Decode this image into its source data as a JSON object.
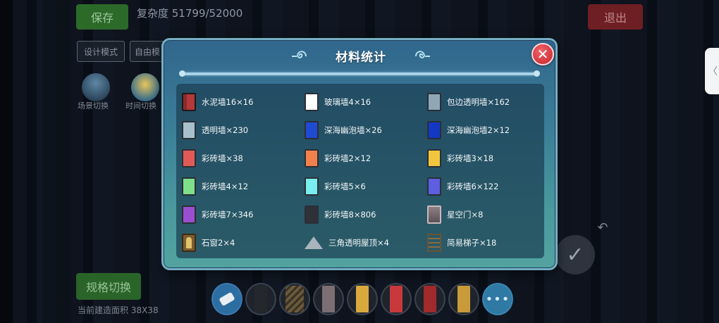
{
  "hud": {
    "save_label": "保存",
    "complexity_text": "复杂度 51799/52000",
    "exit_label": "退出",
    "design_mode_label": "设计模式",
    "free_mode_label": "自由模",
    "scene_toggle_label": "场景切换",
    "time_toggle_label": "时间切换",
    "scene_switch_label": "规格切换",
    "area_text": "当前建造面积 38X38",
    "side_tab_glyph": "〈"
  },
  "dialog": {
    "title": "材料统计",
    "close_glyph": "✕"
  },
  "materials": [
    {
      "label": "水泥墙16×16",
      "icon": "cement-wall",
      "color": "#b3393a"
    },
    {
      "label": "玻璃墙4×16",
      "icon": "glass-wall",
      "color": "#ffffff"
    },
    {
      "label": "包边透明墙×162",
      "icon": "edged-transparent-wall",
      "color": "#8fa7b5"
    },
    {
      "label": "透明墙×230",
      "icon": "transparent-wall",
      "color": "#a8c0cc"
    },
    {
      "label": "深海幽泡墙×26",
      "icon": "deep-sea-bubble-wall",
      "color": "#1f4bd2"
    },
    {
      "label": "深海幽泡墙2×12",
      "icon": "deep-sea-bubble-wall-2",
      "color": "#1238c4"
    },
    {
      "label": "彩砖墙×38",
      "icon": "color-brick-wall",
      "color": "#e25a58"
    },
    {
      "label": "彩砖墙2×12",
      "icon": "color-brick-wall-2",
      "color": "#f0814a"
    },
    {
      "label": "彩砖墙3×18",
      "icon": "color-brick-wall-3",
      "color": "#f2c53f"
    },
    {
      "label": "彩砖墙4×12",
      "icon": "color-brick-wall-4",
      "color": "#7ee08b"
    },
    {
      "label": "彩砖墙5×6",
      "icon": "color-brick-wall-5",
      "color": "#78eef0"
    },
    {
      "label": "彩砖墙6×122",
      "icon": "color-brick-wall-6",
      "color": "#5d5ee0"
    },
    {
      "label": "彩砖墙7×346",
      "icon": "color-brick-wall-7",
      "color": "#9a4fd0"
    },
    {
      "label": "彩砖墙8×806",
      "icon": "color-brick-wall-8",
      "color": "#2e3238"
    },
    {
      "label": "星空门×8",
      "icon": "starry-door",
      "color": "#7b6f74"
    },
    {
      "label": "石窗2×4",
      "icon": "stone-window",
      "color": "#7a5d32"
    },
    {
      "label": "三角透明屋顶×4",
      "icon": "triangle-transparent-roof",
      "color": "#a9b4bd"
    },
    {
      "label": "简易梯子×18",
      "icon": "simple-ladder",
      "color": "#8a6c40"
    }
  ],
  "hotbar": {
    "items": [
      {
        "icon": "eraser-icon",
        "color": "#2d6ea2"
      },
      {
        "icon": "black-wall",
        "color": "#24272c"
      },
      {
        "icon": "stair",
        "color": "#6b5a3b"
      },
      {
        "icon": "starry-door",
        "color": "#7b6f74"
      },
      {
        "icon": "yellow-block",
        "color": "#d9a93d"
      },
      {
        "icon": "red-block",
        "color": "#c7393b"
      },
      {
        "icon": "red-door",
        "color": "#a02a2c"
      },
      {
        "icon": "yellow-window",
        "color": "#c99a3a"
      }
    ],
    "more_glyph": "•••"
  }
}
